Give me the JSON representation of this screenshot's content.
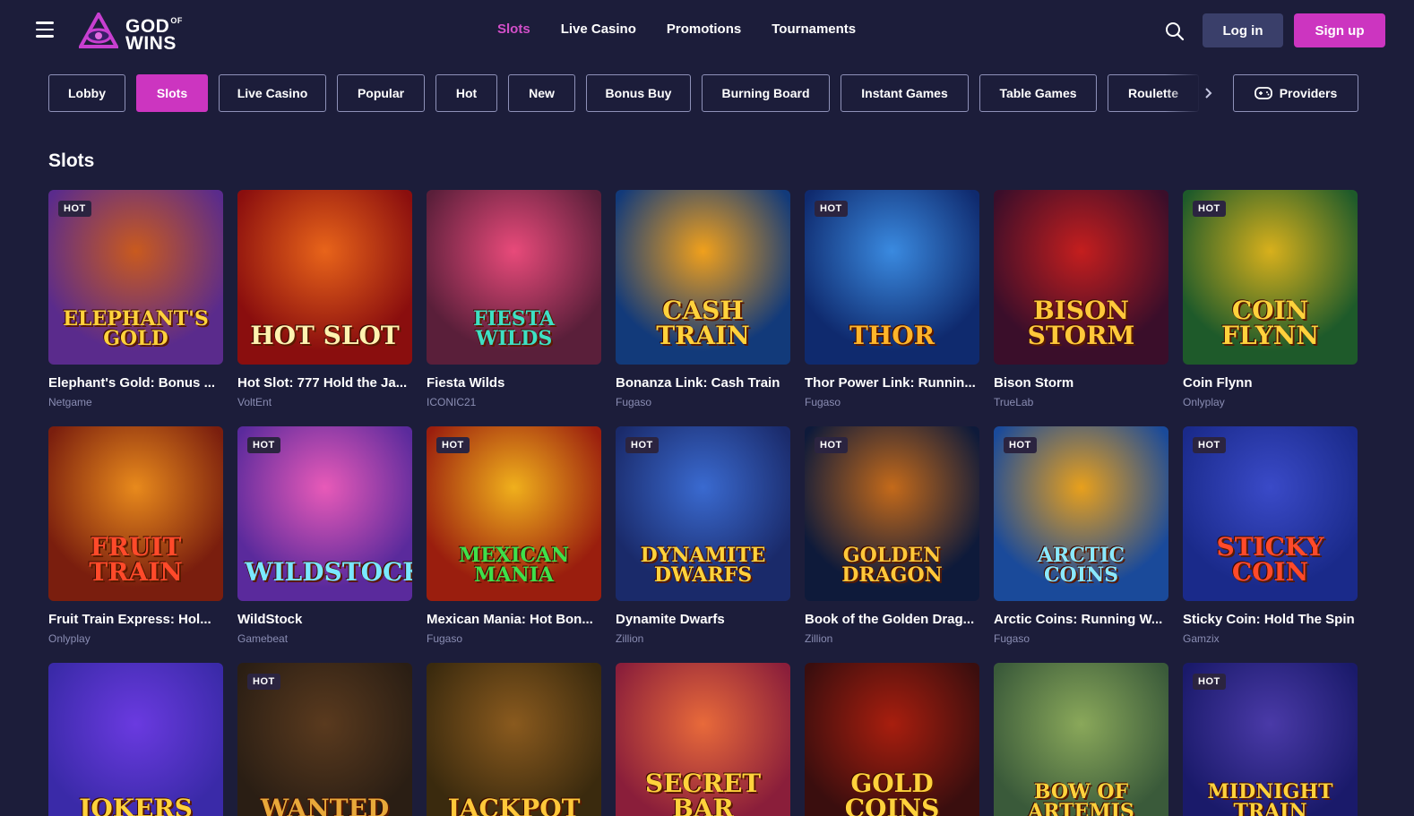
{
  "header": {
    "logo_line1": "GOD",
    "logo_sup": "OF",
    "logo_line2": "WINS",
    "nav": [
      "Slots",
      "Live Casino",
      "Promotions",
      "Tournaments"
    ],
    "active_nav": "Slots",
    "login_label": "Log in",
    "signup_label": "Sign up"
  },
  "categories": [
    "Lobby",
    "Slots",
    "Live Casino",
    "Popular",
    "Hot",
    "New",
    "Bonus Buy",
    "Burning Board",
    "Instant Games",
    "Table Games",
    "Roulette"
  ],
  "active_category": "Slots",
  "providers_label": "Providers",
  "section_title": "Slots",
  "hot_label": "HOT",
  "games": [
    {
      "name": "Elephant's Gold: Bonus ...",
      "provider": "Netgame",
      "hot": true,
      "art_text": "Elephant's Gold",
      "bg": "#5a2b8c",
      "bg2": "#c95a1e",
      "txt": "#ffd23c"
    },
    {
      "name": "Hot Slot: 777 Hold the Ja...",
      "provider": "VoltEnt",
      "hot": false,
      "art_text": "Hot Slot",
      "bg": "#8a0e0e",
      "bg2": "#e8641a",
      "txt": "#fff2b0"
    },
    {
      "name": "Fiesta Wilds",
      "provider": "ICONIC21",
      "hot": false,
      "art_text": "Fiesta Wilds",
      "bg": "#5a1f3a",
      "bg2": "#e84a7a",
      "txt": "#3ee0c4"
    },
    {
      "name": "Bonanza Link: Cash Train",
      "provider": "Fugaso",
      "hot": false,
      "art_text": "Cash Train",
      "bg": "#123a7a",
      "bg2": "#f0a01c",
      "txt": "#ffd23c"
    },
    {
      "name": "Thor Power Link: Runnin...",
      "provider": "Fugaso",
      "hot": true,
      "art_text": "Thor",
      "bg": "#0f2a6e",
      "bg2": "#3a8ae0",
      "txt": "#ffb52a"
    },
    {
      "name": "Bison Storm",
      "provider": "TrueLab",
      "hot": false,
      "art_text": "Bison Storm",
      "bg": "#3a0e2a",
      "bg2": "#c41e1e",
      "txt": "#ffc83a"
    },
    {
      "name": "Coin Flynn",
      "provider": "Onlyplay",
      "hot": true,
      "art_text": "Coin Flynn",
      "bg": "#1e5a2a",
      "bg2": "#d8b01c",
      "txt": "#ffd23c"
    },
    {
      "name": "Fruit Train Express: Hol...",
      "provider": "Onlyplay",
      "hot": false,
      "art_text": "Fruit Train",
      "bg": "#7a1e0e",
      "bg2": "#e88a1c",
      "txt": "#ff4a2a"
    },
    {
      "name": "WildStock",
      "provider": "Gamebeat",
      "hot": true,
      "art_text": "WildStock",
      "bg": "#5a2a9c",
      "bg2": "#e85ab8",
      "txt": "#7ae8ff"
    },
    {
      "name": "Mexican Mania: Hot Bon...",
      "provider": "Fugaso",
      "hot": true,
      "art_text": "Mexican Mania",
      "bg": "#9a1e0e",
      "bg2": "#f0b01c",
      "txt": "#3ee04a"
    },
    {
      "name": "Dynamite Dwarfs",
      "provider": "Zillion",
      "hot": true,
      "art_text": "Dynamite Dwarfs",
      "bg": "#1a2a6a",
      "bg2": "#3a6ad0",
      "txt": "#ffd23c"
    },
    {
      "name": "Book of the Golden Drag...",
      "provider": "Zillion",
      "hot": true,
      "art_text": "Golden Dragon",
      "bg": "#0e1a3a",
      "bg2": "#c46a1a",
      "txt": "#ffc83a"
    },
    {
      "name": "Arctic Coins: Running W...",
      "provider": "Fugaso",
      "hot": true,
      "art_text": "Arctic Coins",
      "bg": "#1a4a9a",
      "bg2": "#e8a01c",
      "txt": "#8ae8ff"
    },
    {
      "name": "Sticky Coin: Hold The Spin",
      "provider": "Gamzix",
      "hot": true,
      "art_text": "Sticky Coin",
      "bg": "#1a2a8a",
      "bg2": "#3a4ac8",
      "txt": "#ff4a2a"
    },
    {
      "name": "",
      "provider": "",
      "hot": false,
      "art_text": "Jokers",
      "bg": "#3a2aa8",
      "bg2": "#6a3ae0",
      "txt": "#ffd23c"
    },
    {
      "name": "",
      "provider": "",
      "hot": true,
      "art_text": "Wanted",
      "bg": "#2a1e14",
      "bg2": "#5a3a1e",
      "txt": "#e8a83a"
    },
    {
      "name": "",
      "provider": "",
      "hot": false,
      "art_text": "Jackpot",
      "bg": "#3a2a0e",
      "bg2": "#8a5a1e",
      "txt": "#ffc83a"
    },
    {
      "name": "",
      "provider": "",
      "hot": false,
      "art_text": "Secret Bar",
      "bg": "#8a1e3a",
      "bg2": "#e86a3a",
      "txt": "#ffd23c"
    },
    {
      "name": "",
      "provider": "",
      "hot": false,
      "art_text": "Gold Coins",
      "bg": "#3a0e0e",
      "bg2": "#a81e0e",
      "txt": "#ffd23c"
    },
    {
      "name": "",
      "provider": "",
      "hot": false,
      "art_text": "Bow of Artemis",
      "bg": "#3a5a3a",
      "bg2": "#8aa85a",
      "txt": "#ffd23c"
    },
    {
      "name": "",
      "provider": "",
      "hot": true,
      "art_text": "Midnight Train",
      "bg": "#1a1a6a",
      "bg2": "#4a3aa8",
      "txt": "#ffd23c"
    }
  ]
}
